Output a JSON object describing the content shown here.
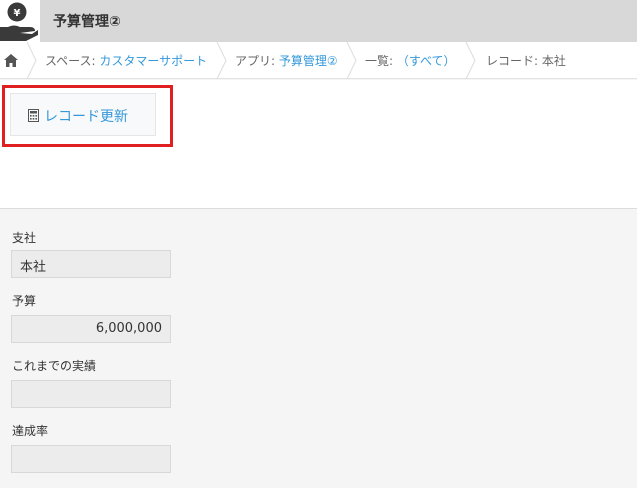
{
  "header": {
    "app_title": "予算管理②",
    "app_icon": "money-hand-icon"
  },
  "breadcrumb": {
    "home_icon": "home-icon",
    "space_prefix": "スペース: ",
    "space_name": "カスタマーサポート",
    "app_prefix": "アプリ: ",
    "app_name": "予算管理②",
    "list_prefix": "一覧: ",
    "list_name": "（すべて）",
    "record_label": "レコード: 本社"
  },
  "toolbar": {
    "update_button_label": "レコード更新",
    "update_button_icon": "calculator-icon"
  },
  "fields": [
    {
      "label": "支社",
      "value": "本社"
    },
    {
      "label": "予算",
      "value": "6,000,000"
    },
    {
      "label": "これまでの実績",
      "value": ""
    },
    {
      "label": "達成率",
      "value": ""
    }
  ],
  "colors": {
    "link": "#3498db",
    "highlight": "#e02020",
    "header_bg": "#d8d8d8"
  }
}
